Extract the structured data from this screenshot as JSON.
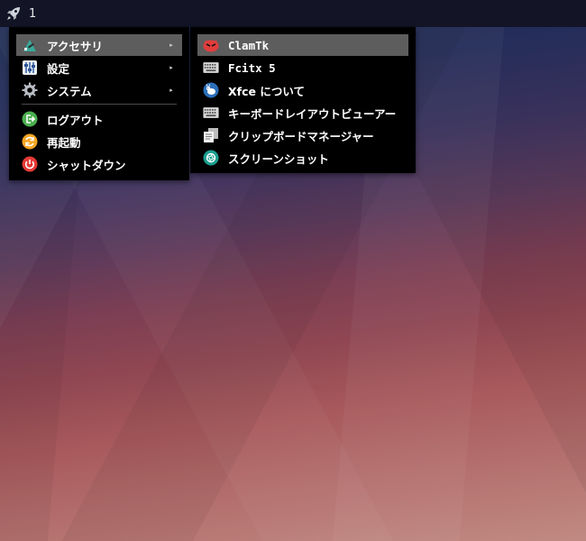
{
  "panel": {
    "launcher_icon": "rocket-icon",
    "workspace": "1"
  },
  "main_menu": {
    "items": [
      {
        "label": "アクセサリ",
        "icon": "accessories-icon",
        "submenu": true
      },
      {
        "label": "設定",
        "icon": "settings-icon",
        "submenu": true
      },
      {
        "label": "システム",
        "icon": "system-gear-icon",
        "submenu": true
      },
      {
        "label": "ログアウト",
        "icon": "logout-icon",
        "submenu": false
      },
      {
        "label": "再起動",
        "icon": "restart-icon",
        "submenu": false
      },
      {
        "label": "シャットダウン",
        "icon": "power-icon",
        "submenu": false
      }
    ],
    "arrow": "▸"
  },
  "sub_menu": {
    "items": [
      {
        "label": "ClamTk",
        "icon": "clamtk-icon"
      },
      {
        "label": "Fcitx 5",
        "icon": "keyboard-icon"
      },
      {
        "label": "Xfce について",
        "icon": "xfce-mouse-icon"
      },
      {
        "label": "キーボードレイアウトビューアー",
        "icon": "keyboard-layout-icon"
      },
      {
        "label": "クリップボードマネージャー",
        "icon": "clipboard-icon"
      },
      {
        "label": "スクリーンショット",
        "icon": "screenshot-icon"
      }
    ]
  },
  "colors": {
    "panel_bg": "#131527",
    "menu_bg": "#000000",
    "highlight": "#5d5d5d"
  }
}
